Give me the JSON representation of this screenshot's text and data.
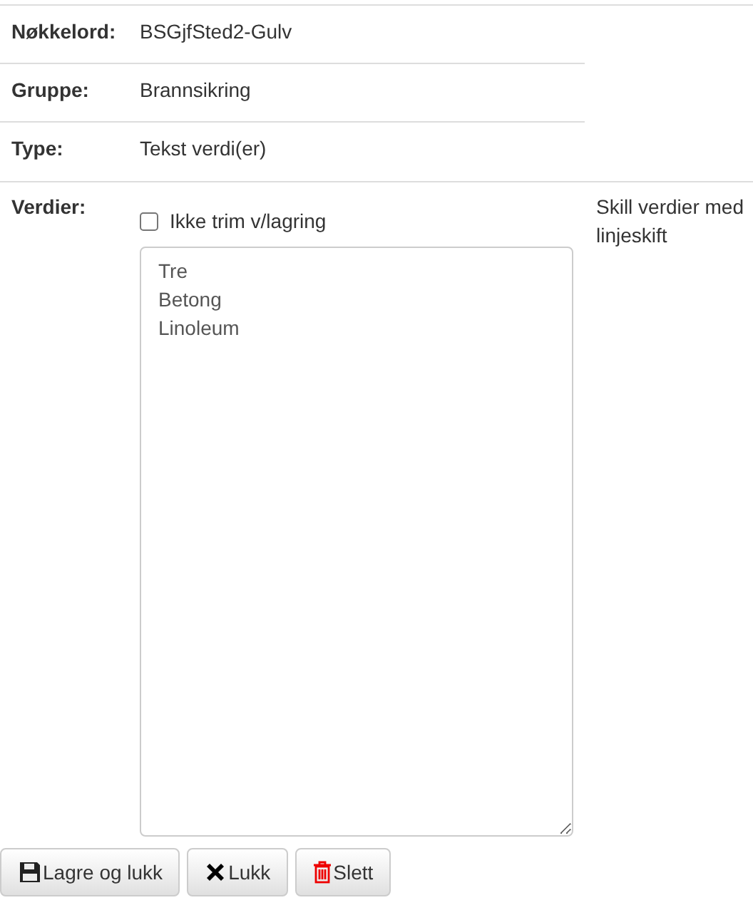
{
  "fields": [
    {
      "label": "Nøkkelord:",
      "value": "BSGjfSted2-Gulv"
    },
    {
      "label": "Gruppe:",
      "value": "Brannsikring"
    },
    {
      "label": "Type:",
      "value": "Tekst verdi(er)"
    }
  ],
  "values_section": {
    "label": "Verdier:",
    "checkbox": {
      "label": "Ikke trim v/lagring",
      "checked": false
    },
    "textarea_value": "Tre\nBetong\nLinoleum",
    "help": "Skill verdier med linjeskift"
  },
  "buttons": [
    {
      "kind": "save",
      "label": "Lagre og lukk"
    },
    {
      "kind": "close",
      "label": "Lukk"
    },
    {
      "kind": "delete",
      "label": "Slett"
    }
  ]
}
